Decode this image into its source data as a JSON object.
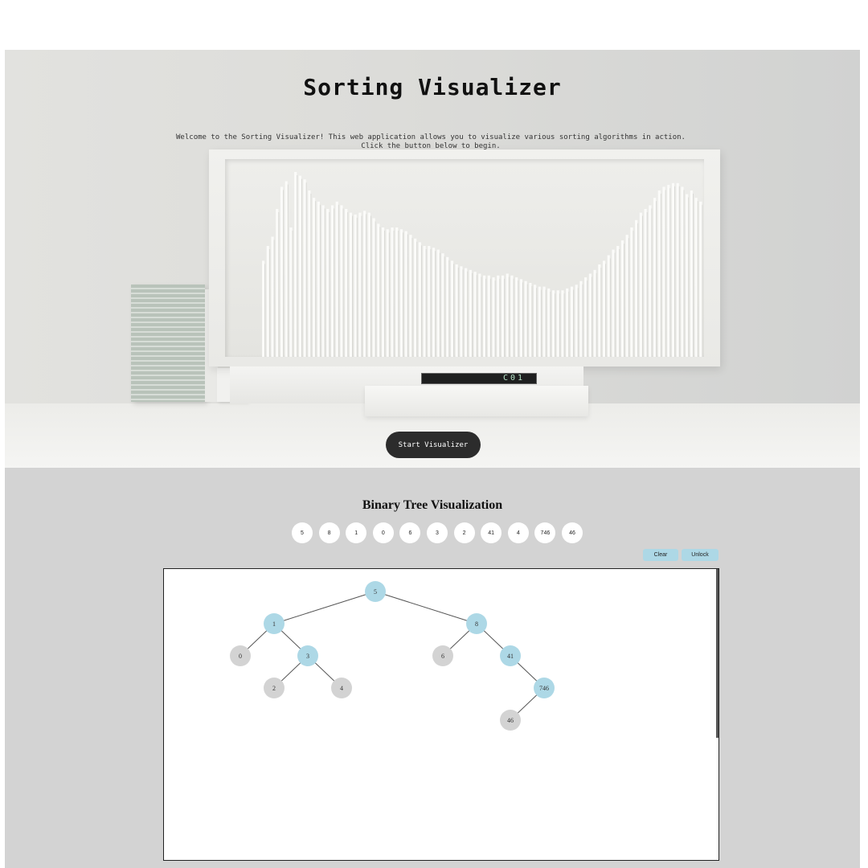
{
  "hero": {
    "title": "Sorting Visualizer",
    "description_line1": "Welcome to the Sorting Visualizer! This web application allows you to visualize various sorting algorithms in action.",
    "description_line2": "Click the button below to begin.",
    "start_button": "Start Visualizer",
    "display_text": "C01",
    "bar_heights": [
      0.52,
      0.6,
      0.65,
      0.8,
      0.92,
      0.95,
      0.7,
      1.0,
      0.98,
      0.96,
      0.9,
      0.86,
      0.84,
      0.82,
      0.8,
      0.82,
      0.84,
      0.82,
      0.8,
      0.78,
      0.77,
      0.78,
      0.79,
      0.78,
      0.75,
      0.72,
      0.7,
      0.69,
      0.7,
      0.7,
      0.69,
      0.68,
      0.66,
      0.64,
      0.62,
      0.6,
      0.6,
      0.59,
      0.58,
      0.56,
      0.54,
      0.52,
      0.5,
      0.49,
      0.48,
      0.47,
      0.46,
      0.45,
      0.44,
      0.44,
      0.43,
      0.44,
      0.44,
      0.45,
      0.44,
      0.43,
      0.42,
      0.41,
      0.4,
      0.39,
      0.38,
      0.38,
      0.37,
      0.36,
      0.36,
      0.36,
      0.37,
      0.38,
      0.39,
      0.41,
      0.43,
      0.45,
      0.47,
      0.5,
      0.52,
      0.55,
      0.58,
      0.6,
      0.63,
      0.66,
      0.7,
      0.74,
      0.78,
      0.8,
      0.82,
      0.86,
      0.9,
      0.92,
      0.93,
      0.94,
      0.94,
      0.92,
      0.88,
      0.9,
      0.86,
      0.84
    ]
  },
  "tree": {
    "title": "Binary Tree Visualization",
    "input_values": [
      "5",
      "8",
      "1",
      "0",
      "6",
      "3",
      "2",
      "41",
      "4",
      "746",
      "46"
    ],
    "buttons": {
      "clear": "Clear",
      "unlock": "Unlock"
    },
    "colors": {
      "highlight": "#add8e6",
      "default": "#d3d3d3",
      "edge": "#555555"
    },
    "nodes": [
      {
        "id": "n5",
        "label": "5",
        "highlighted": true
      },
      {
        "id": "n1",
        "label": "1",
        "highlighted": true
      },
      {
        "id": "n8",
        "label": "8",
        "highlighted": true
      },
      {
        "id": "n0",
        "label": "0",
        "highlighted": false
      },
      {
        "id": "n3",
        "label": "3",
        "highlighted": true
      },
      {
        "id": "n6",
        "label": "6",
        "highlighted": false
      },
      {
        "id": "n41",
        "label": "41",
        "highlighted": true
      },
      {
        "id": "n2",
        "label": "2",
        "highlighted": false
      },
      {
        "id": "n4",
        "label": "4",
        "highlighted": false
      },
      {
        "id": "n746",
        "label": "746",
        "highlighted": true
      },
      {
        "id": "n46",
        "label": "46",
        "highlighted": false
      }
    ],
    "edges": [
      [
        "n5",
        "n1"
      ],
      [
        "n5",
        "n8"
      ],
      [
        "n1",
        "n0"
      ],
      [
        "n1",
        "n3"
      ],
      [
        "n3",
        "n2"
      ],
      [
        "n3",
        "n4"
      ],
      [
        "n8",
        "n6"
      ],
      [
        "n8",
        "n41"
      ],
      [
        "n41",
        "n746"
      ],
      [
        "n746",
        "n46"
      ]
    ]
  }
}
